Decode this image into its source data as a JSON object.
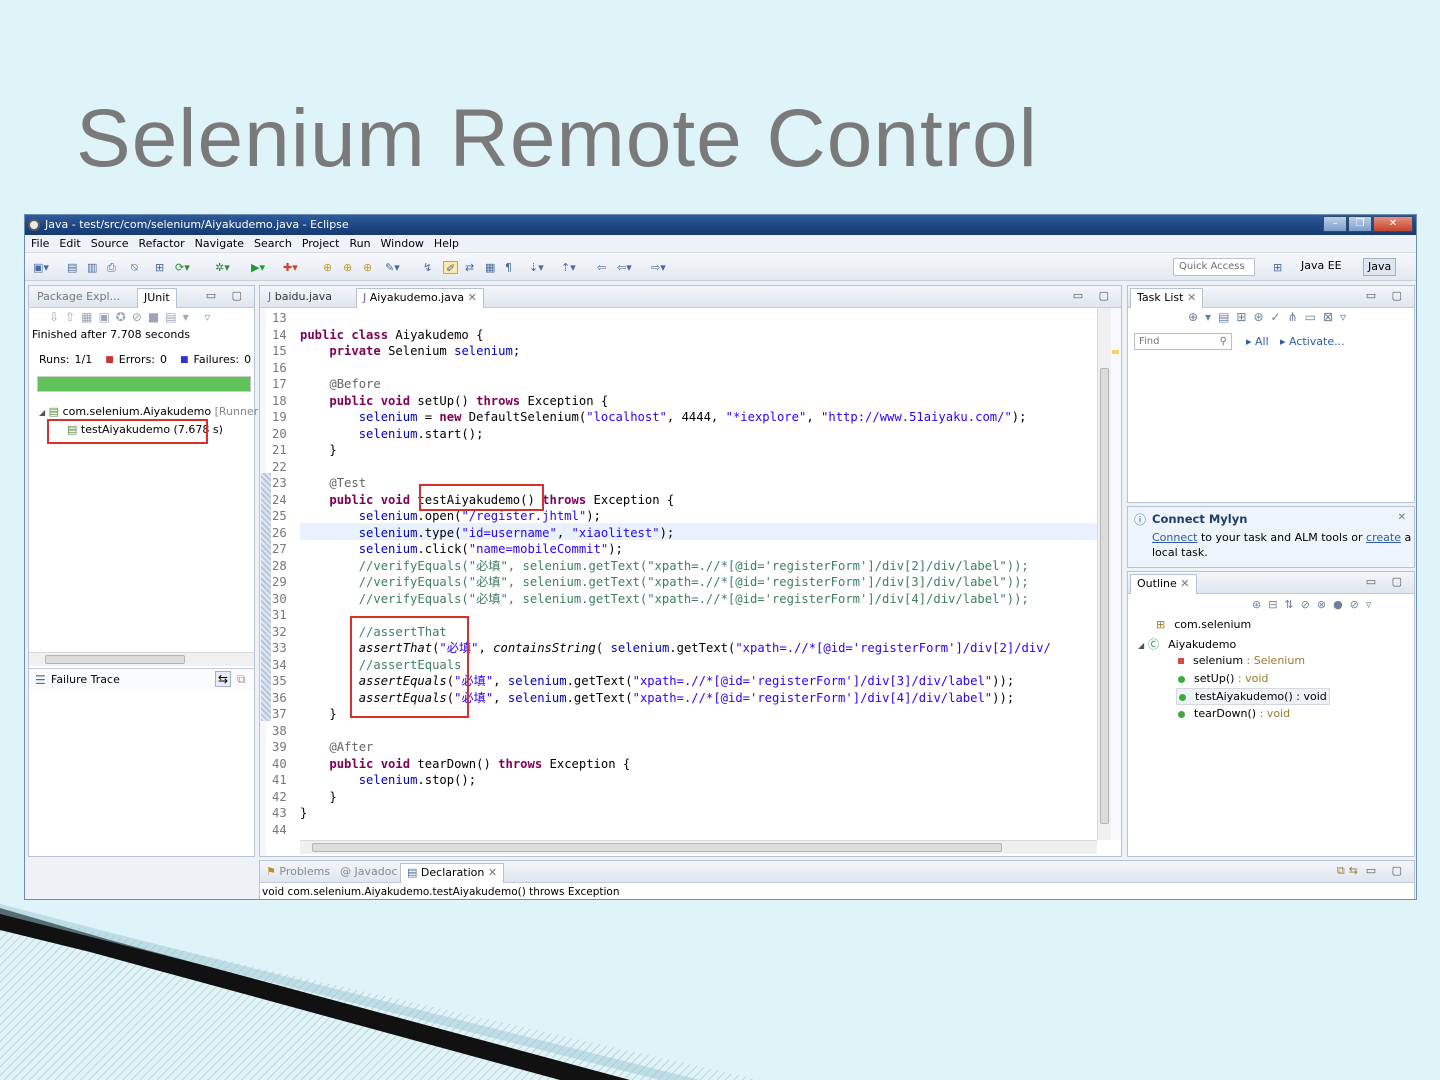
{
  "slide": {
    "title": "Selenium Remote Control"
  },
  "window": {
    "title": "Java - test/src/com/selenium/Aiyakudemo.java - Eclipse",
    "menu": [
      "File",
      "Edit",
      "Source",
      "Refactor",
      "Navigate",
      "Search",
      "Project",
      "Run",
      "Window",
      "Help"
    ],
    "quick_access": "Quick Access",
    "perspectives": [
      "Java EE",
      "Java"
    ]
  },
  "left_panel": {
    "tabs": [
      "Package Expl...",
      "JUnit"
    ],
    "finished": "Finished after 7.708 seconds",
    "runs_label": "Runs:",
    "runs_value": "1/1",
    "errors_label": "Errors:",
    "errors_value": "0",
    "failures_label": "Failures:",
    "failures_value": "0",
    "progress_fraction": 1.0,
    "tree_root": "com.selenium.Aiyakudemo",
    "tree_root_runner": "[Runner: J",
    "tree_child": "testAiyakudemo (7.678 s)",
    "failure_trace": "Failure Trace"
  },
  "editor": {
    "tabs": [
      "baidu.java",
      "Aiyakudemo.java"
    ],
    "line_numbers": [
      "13",
      "14",
      "15",
      "16",
      "17",
      "18",
      "19",
      "20",
      "21",
      "22",
      "23",
      "24",
      "25",
      "26",
      "27",
      "28",
      "29",
      "30",
      "31",
      "32",
      "33",
      "34",
      "35",
      "36",
      "37",
      "38",
      "39",
      "40",
      "41",
      "42",
      "43",
      "44"
    ],
    "lines": [
      [],
      [
        [
          "kw",
          "public class "
        ],
        [
          "",
          "Aiyakudemo {"
        ]
      ],
      [
        [
          "",
          "    "
        ],
        [
          "kw",
          "private "
        ],
        [
          "",
          "Selenium "
        ],
        [
          "fld",
          "selenium"
        ],
        [
          "",
          ";"
        ]
      ],
      [],
      [
        [
          "",
          "    "
        ],
        [
          "ann",
          "@Before"
        ]
      ],
      [
        [
          "",
          "    "
        ],
        [
          "kw",
          "public void "
        ],
        [
          "",
          "setUp() "
        ],
        [
          "kw",
          "throws "
        ],
        [
          "",
          "Exception {"
        ]
      ],
      [
        [
          "",
          "        "
        ],
        [
          "fld",
          "selenium"
        ],
        [
          "",
          " = "
        ],
        [
          "kw",
          "new "
        ],
        [
          "",
          "DefaultSelenium("
        ],
        [
          "str",
          "\"localhost\""
        ],
        [
          "",
          ", 4444, "
        ],
        [
          "str",
          "\"*iexplore\""
        ],
        [
          "",
          ", "
        ],
        [
          "str",
          "\"http://www.51aiyaku.com/\""
        ],
        [
          "",
          ");"
        ]
      ],
      [
        [
          "",
          "        "
        ],
        [
          "fld",
          "selenium"
        ],
        [
          "",
          ".start();"
        ]
      ],
      [
        [
          "",
          "    }"
        ]
      ],
      [],
      [
        [
          "",
          "    "
        ],
        [
          "ann",
          "@Test"
        ]
      ],
      [
        [
          "",
          "    "
        ],
        [
          "kw",
          "public void "
        ],
        [
          "",
          "testAiyakudemo() "
        ],
        [
          "kw",
          "throws "
        ],
        [
          "",
          "Exception {"
        ]
      ],
      [
        [
          "",
          "        "
        ],
        [
          "fld",
          "selenium"
        ],
        [
          "",
          ".open("
        ],
        [
          "str",
          "\"/register.jhtml\""
        ],
        [
          "",
          ");"
        ]
      ],
      [
        [
          "",
          "        "
        ],
        [
          "fld",
          "selenium"
        ],
        [
          "",
          ".type("
        ],
        [
          "str",
          "\"id=username\""
        ],
        [
          "",
          ", "
        ],
        [
          "str",
          "\"xiaolitest\""
        ],
        [
          "",
          ");"
        ]
      ],
      [
        [
          "",
          "        "
        ],
        [
          "fld",
          "selenium"
        ],
        [
          "",
          ".click("
        ],
        [
          "str",
          "\"name=mobileCommit\""
        ],
        [
          "",
          ");"
        ]
      ],
      [
        [
          "cmt",
          "        //verifyEquals(\"必填\", selenium.getText(\"xpath=.//*[@id='registerForm']/div[2]/div/label\"));"
        ]
      ],
      [
        [
          "cmt",
          "        //verifyEquals(\"必填\", selenium.getText(\"xpath=.//*[@id='registerForm']/div[3]/div/label\"));"
        ]
      ],
      [
        [
          "cmt",
          "        //verifyEquals(\"必填\", selenium.getText(\"xpath=.//*[@id='registerForm']/div[4]/div/label\"));"
        ]
      ],
      [],
      [
        [
          "cmt",
          "        //assertThat"
        ]
      ],
      [
        [
          "",
          "        "
        ],
        [
          "it",
          "assertThat"
        ],
        [
          "",
          "("
        ],
        [
          "str",
          "\"必填\""
        ],
        [
          "",
          ", "
        ],
        [
          "it",
          "containsString"
        ],
        [
          "",
          "( "
        ],
        [
          "fld",
          "selenium"
        ],
        [
          "",
          ".getText("
        ],
        [
          "str",
          "\"xpath=.//*[@id='registerForm']/div[2]/div/"
        ]
      ],
      [
        [
          "cmt",
          "        //assertEquals"
        ]
      ],
      [
        [
          "",
          "        "
        ],
        [
          "it",
          "assertEquals"
        ],
        [
          "",
          "("
        ],
        [
          "str",
          "\"必填\""
        ],
        [
          "",
          ", "
        ],
        [
          "fld",
          "selenium"
        ],
        [
          "",
          ".getText("
        ],
        [
          "str",
          "\"xpath=.//*[@id='registerForm']/div[3]/div/label\""
        ],
        [
          "",
          "));"
        ]
      ],
      [
        [
          "",
          "        "
        ],
        [
          "it",
          "assertEquals"
        ],
        [
          "",
          "("
        ],
        [
          "str",
          "\"必填\""
        ],
        [
          "",
          ", "
        ],
        [
          "fld",
          "selenium"
        ],
        [
          "",
          ".getText("
        ],
        [
          "str",
          "\"xpath=.//*[@id='registerForm']/div[4]/div/label\""
        ],
        [
          "",
          "));"
        ]
      ],
      [
        [
          "",
          "    }"
        ]
      ],
      [],
      [
        [
          "",
          "    "
        ],
        [
          "ann",
          "@After"
        ]
      ],
      [
        [
          "",
          "    "
        ],
        [
          "kw",
          "public void "
        ],
        [
          "",
          "tearDown() "
        ],
        [
          "kw",
          "throws "
        ],
        [
          "",
          "Exception {"
        ]
      ],
      [
        [
          "",
          "        "
        ],
        [
          "fld",
          "selenium"
        ],
        [
          "",
          ".stop();"
        ]
      ],
      [
        [
          "",
          "    }"
        ]
      ],
      [
        [
          "",
          "}"
        ]
      ],
      []
    ]
  },
  "task_list": {
    "tab": "Task List",
    "find_placeholder": "Find",
    "all": "All",
    "activate": "Activate..."
  },
  "mylyn": {
    "title": "Connect Mylyn",
    "connect": "Connect",
    "text1": " to your task and ALM tools or ",
    "create": "create",
    "text2": " a",
    "text3": "local task."
  },
  "outline": {
    "tab": "Outline",
    "package": "com.selenium",
    "class": "Aiyakudemo",
    "items": [
      {
        "name": "selenium",
        "type": " : Selenium"
      },
      {
        "name": "setUp()",
        "type": " : void"
      },
      {
        "name": "testAiyakudemo()",
        "type": " : void"
      },
      {
        "name": "tearDown()",
        "type": " : void"
      }
    ]
  },
  "bottom": {
    "tabs": [
      "Problems",
      "Javadoc",
      "Declaration"
    ],
    "declaration": "void com.selenium.Aiyakudemo.testAiyakudemo() throws Exception"
  }
}
